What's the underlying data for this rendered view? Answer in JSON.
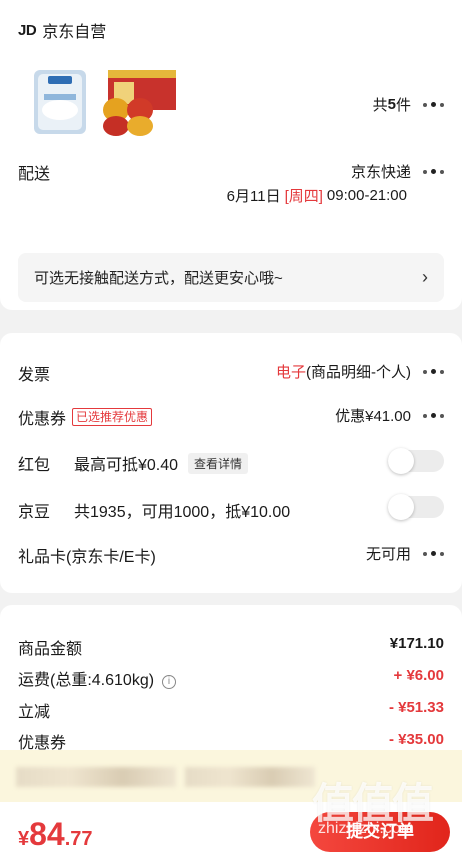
{
  "shop": {
    "logo": "JD",
    "name": "京东自营"
  },
  "items": {
    "count_prefix": "共",
    "count": "5",
    "count_suffix": "件"
  },
  "delivery": {
    "label": "配送",
    "carrier": "京东快递",
    "date": "6月11日",
    "weekday": "[周四]",
    "time": "09:00-21:00"
  },
  "tip": {
    "text": "可选无接触配送方式，配送更安心哦~",
    "arrow": "›"
  },
  "invoice": {
    "label": "发票",
    "type": "电子",
    "detail": "(商品明细-个人)"
  },
  "coupon": {
    "label": "优惠券",
    "tag": "已选推荐优惠",
    "value": "优惠¥41.00"
  },
  "redpacket": {
    "label": "红包",
    "desc": "最高可抵¥0.40",
    "detail_btn": "查看详情"
  },
  "jingdou": {
    "label": "京豆",
    "desc": "共1935，可用1000，抵¥10.00"
  },
  "giftcard": {
    "label": "礼品卡(京东卡/E卡)",
    "value": "无可用"
  },
  "summary": {
    "goods_label": "商品金额",
    "goods_value": "¥171.10",
    "shipping_label": "运费(总重:4.610kg)",
    "shipping_value": "+ ¥6.00",
    "discount_label": "立减",
    "discount_value": "- ¥51.33",
    "coupon_label": "优惠券",
    "coupon_value": "- ¥35.00"
  },
  "total": {
    "currency": "¥",
    "integer": "84",
    "decimal": ".77"
  },
  "submit_label": "提交订单",
  "watermark": {
    "text": "值值值",
    "url": "zhizhizhi.com"
  },
  "colors": {
    "accent": "#e4393c",
    "tip_bg": "#f5f5f5",
    "notice_bg": "#fbf6dd"
  }
}
